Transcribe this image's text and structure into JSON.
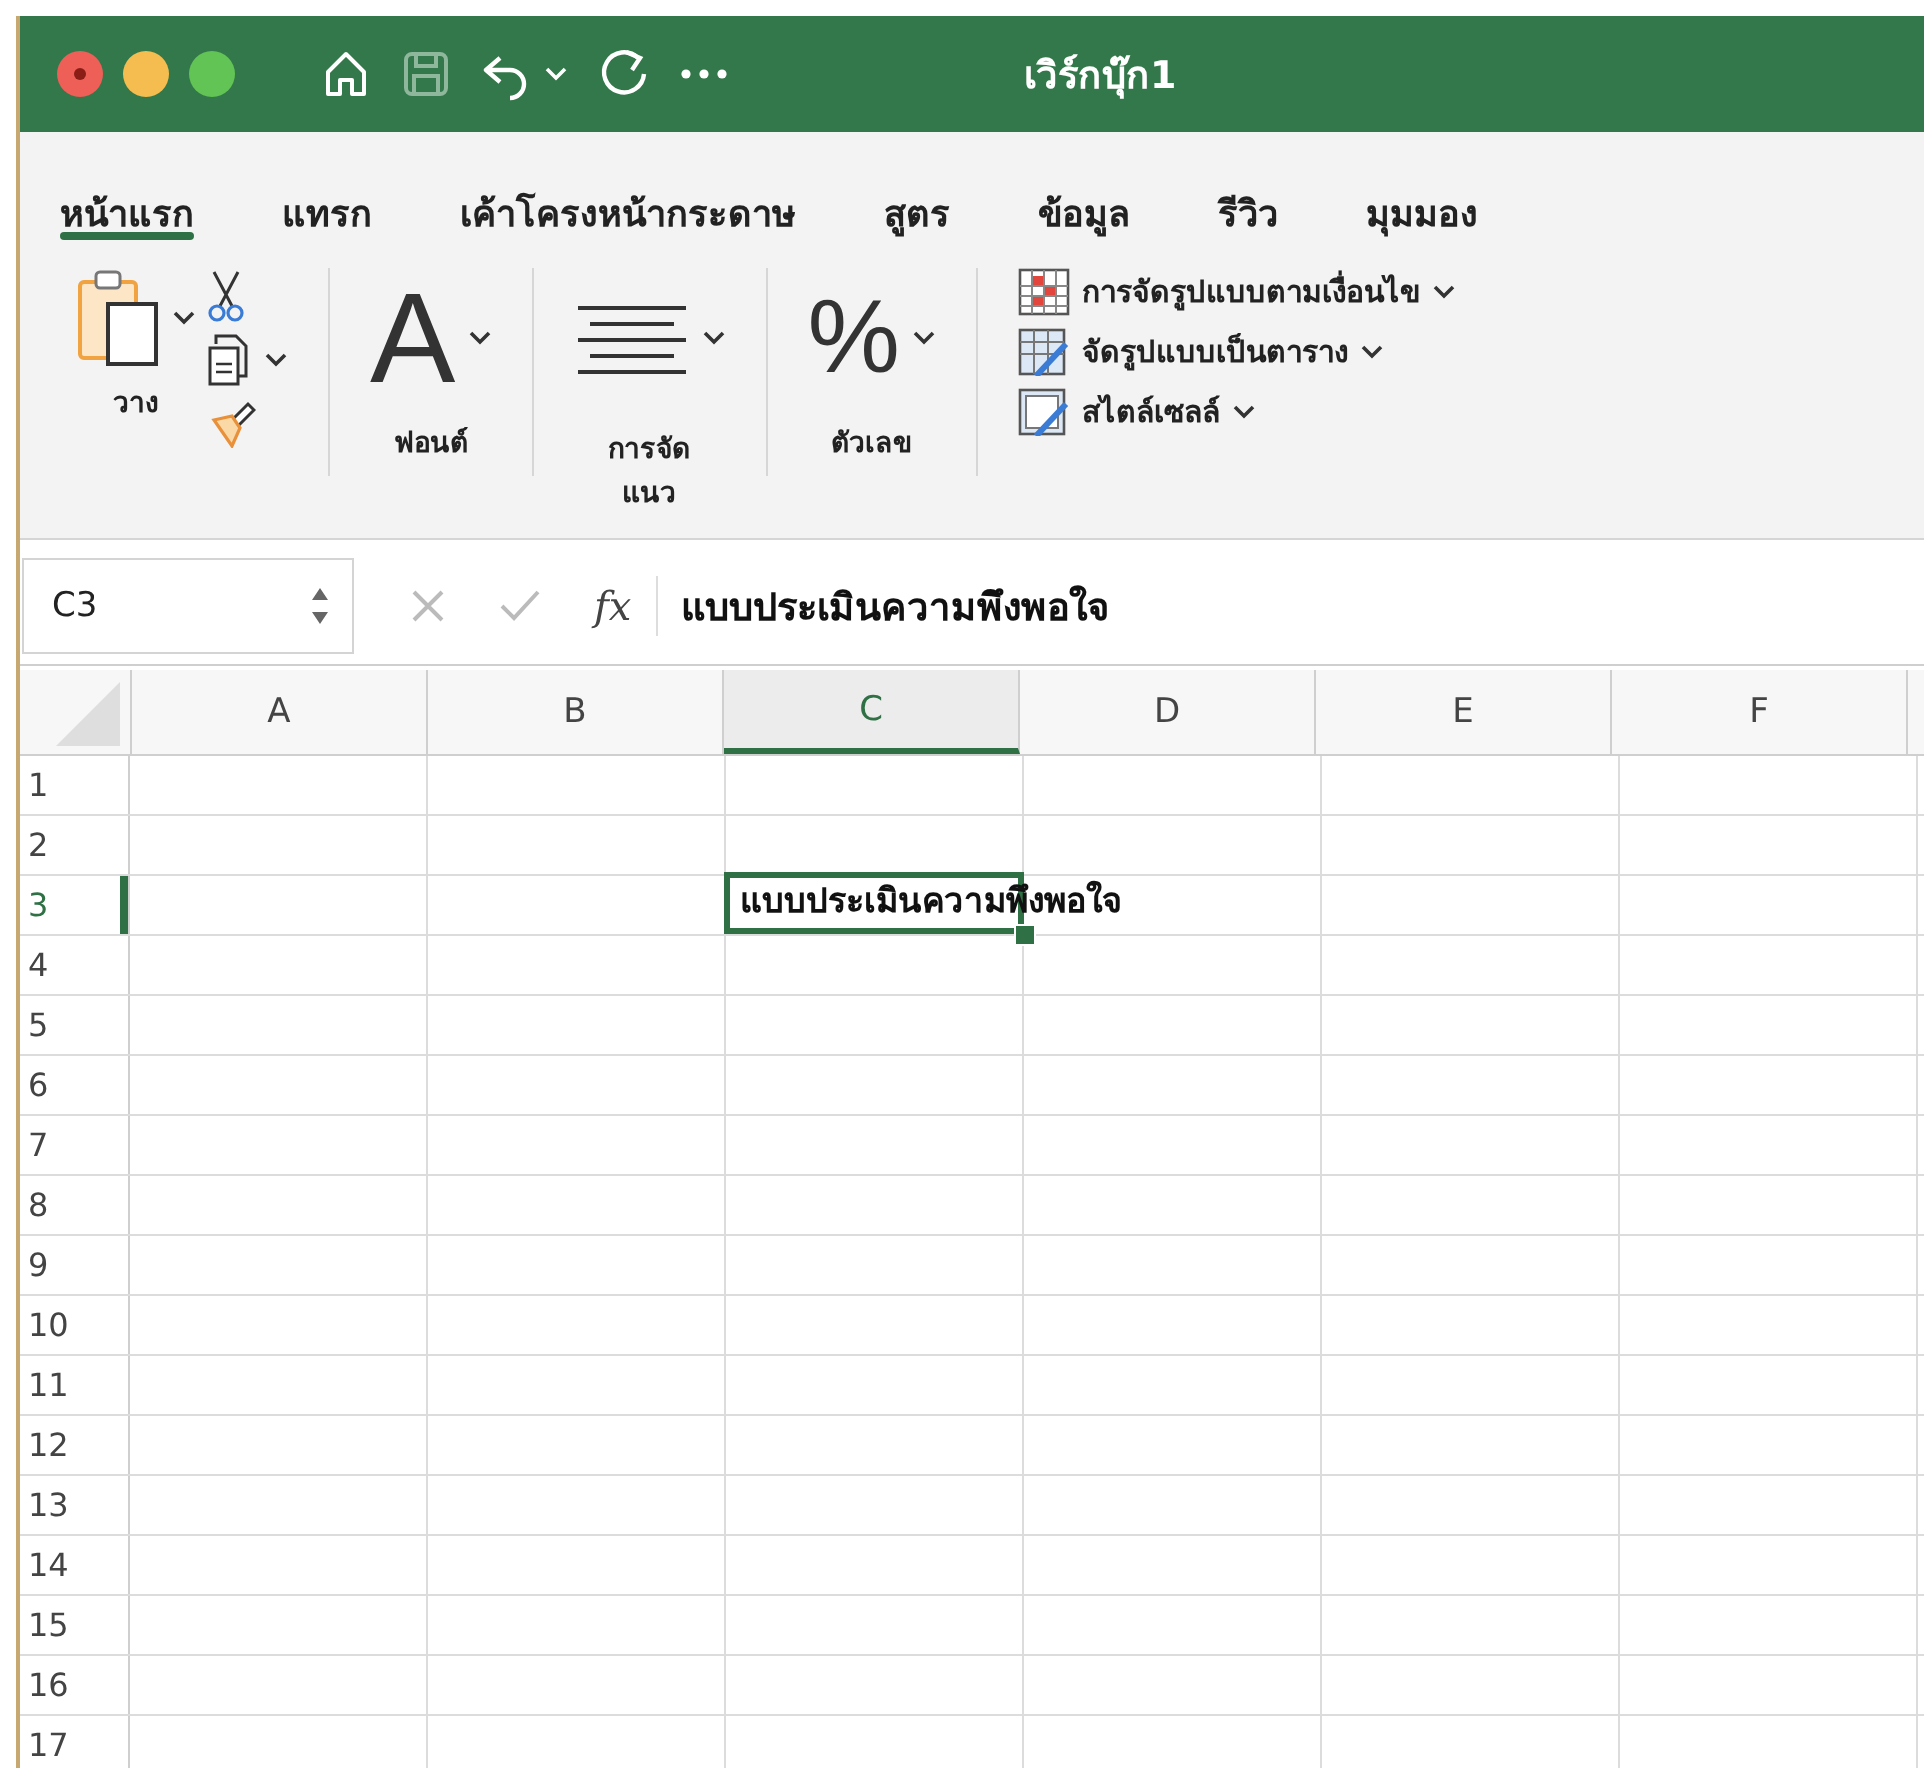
{
  "window": {
    "title": "เวิร์กบุ๊ก1"
  },
  "ribbon_tabs": [
    {
      "label": "หน้าแรก",
      "selected": true
    },
    {
      "label": "แทรก",
      "selected": false
    },
    {
      "label": "เค้าโครงหน้ากระดาษ",
      "selected": false
    },
    {
      "label": "สูตร",
      "selected": false
    },
    {
      "label": "ข้อมูล",
      "selected": false
    },
    {
      "label": "รีวิว",
      "selected": false
    },
    {
      "label": "มุมมอง",
      "selected": false
    }
  ],
  "ribbon": {
    "clipboard": {
      "label": "วาง"
    },
    "font": {
      "icon": "A",
      "label": "ฟอนต์"
    },
    "alignment": {
      "label": "การจัดแนว"
    },
    "number": {
      "icon": "%",
      "label": "ตัวเลข"
    },
    "styles": [
      {
        "kind": "conditional",
        "label": "การจัดรูปแบบตามเงื่อนไข"
      },
      {
        "kind": "table",
        "label": "จัดรูปแบบเป็นตาราง"
      },
      {
        "kind": "cellstyle",
        "label": "สไตล์เซลล์"
      }
    ]
  },
  "formula_bar": {
    "name_box": "C3",
    "function_label": "fx",
    "formula": "แบบประเมินความพึงพอใจ"
  },
  "sheet": {
    "columns": [
      {
        "label": "A",
        "selected": false
      },
      {
        "label": "B",
        "selected": false
      },
      {
        "label": "C",
        "selected": true
      },
      {
        "label": "D",
        "selected": false
      },
      {
        "label": "E",
        "selected": false
      },
      {
        "label": "F",
        "selected": false
      }
    ],
    "rows": [
      {
        "label": "1",
        "selected": false
      },
      {
        "label": "2",
        "selected": false
      },
      {
        "label": "3",
        "selected": true,
        "cells": [
          null,
          null,
          {
            "text": "แบบประเมินความพึงพอใจ",
            "selected": true
          }
        ]
      },
      {
        "label": "4",
        "selected": false
      },
      {
        "label": "5",
        "selected": false
      },
      {
        "label": "6",
        "selected": false
      },
      {
        "label": "7",
        "selected": false
      },
      {
        "label": "8",
        "selected": false
      },
      {
        "label": "9",
        "selected": false
      },
      {
        "label": "10",
        "selected": false
      },
      {
        "label": "11",
        "selected": false
      },
      {
        "label": "12",
        "selected": false
      },
      {
        "label": "13",
        "selected": false
      },
      {
        "label": "14",
        "selected": false
      },
      {
        "label": "15",
        "selected": false
      },
      {
        "label": "16",
        "selected": false
      },
      {
        "label": "17",
        "selected": false
      }
    ]
  }
}
